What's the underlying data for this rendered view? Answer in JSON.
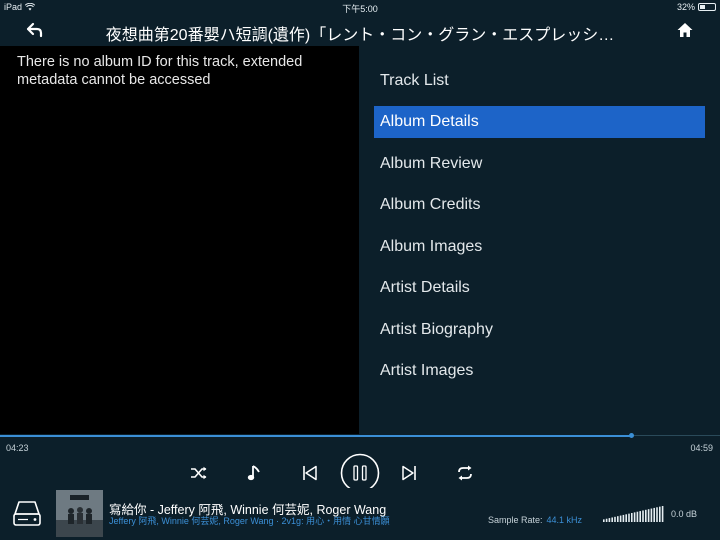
{
  "status": {
    "device": "iPad",
    "time": "下午5:00",
    "battery": "32%",
    "battery_level": 0.32
  },
  "header": {
    "title": "夜想曲第20番嬰ハ短調(遺作)「レント・コン・グラン・エスプレッシ…",
    "back_icon": "back-arrow-icon",
    "home_icon": "home-icon"
  },
  "left_pane": {
    "message": "There is no album ID for this track, extended metadata cannot be accessed"
  },
  "menu": {
    "items": [
      {
        "label": "Track List",
        "active": false
      },
      {
        "label": "Album Details",
        "active": true
      },
      {
        "label": "Album Review",
        "active": false
      },
      {
        "label": "Album Credits",
        "active": false
      },
      {
        "label": "Album Images",
        "active": false
      },
      {
        "label": "Artist Details",
        "active": false
      },
      {
        "label": "Artist Biography",
        "active": false
      },
      {
        "label": "Artist Images",
        "active": false
      }
    ]
  },
  "playback": {
    "elapsed": "04:23",
    "total": "04:59",
    "progress": 0.877,
    "state": "playing"
  },
  "now_playing": {
    "title": "寫給你 - Jeffery 阿飛, Winnie 何芸妮, Roger Wang",
    "subtitle": "Jeffery 阿飛, Winnie 何芸妮, Roger Wang · 2v1g: 用心・用情 心甘情願",
    "sample_rate_label": "Sample Rate:",
    "sample_rate_value": "44.1 kHz",
    "volume_label": "0.0 dB",
    "volume_level": 1.0
  },
  "colors": {
    "accent": "#1d64c8",
    "progress": "#3b8fd6",
    "background": "#0c1f2a"
  }
}
